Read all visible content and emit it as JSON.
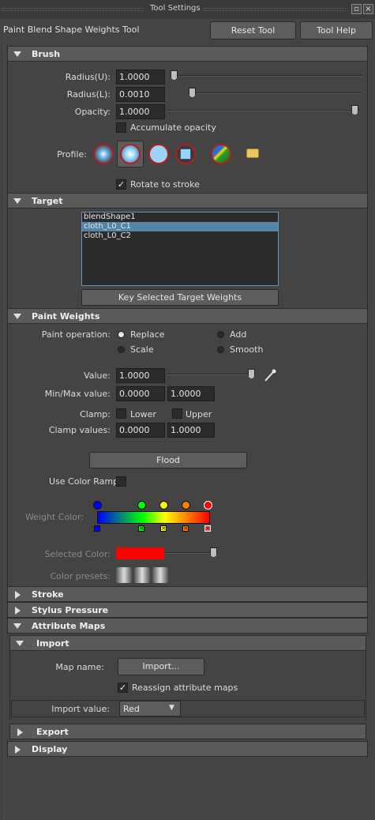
{
  "window": {
    "title": "Tool Settings"
  },
  "tool": {
    "name": "Paint Blend Shape Weights Tool",
    "reset_label": "Reset Tool",
    "help_label": "Tool Help"
  },
  "brush": {
    "header": "Brush",
    "radius_u_label": "Radius(U):",
    "radius_u_value": "1.0000",
    "radius_l_label": "Radius(L):",
    "radius_l_value": "0.0010",
    "opacity_label": "Opacity:",
    "opacity_value": "1.0000",
    "accumulate_label": "Accumulate opacity",
    "profile_label": "Profile:",
    "rotate_label": "Rotate to stroke"
  },
  "target": {
    "header": "Target",
    "items": [
      "blendShape1",
      "cloth_L0_C1",
      "cloth_L0_C2"
    ],
    "selected": "cloth_L0_C1",
    "key_button": "Key Selected Target Weights"
  },
  "paint_weights": {
    "header": "Paint Weights",
    "operation_label": "Paint operation:",
    "ops": [
      "Replace",
      "Add",
      "Scale",
      "Smooth"
    ],
    "selected_op": "Replace",
    "value_label": "Value:",
    "value": "1.0000",
    "minmax_label": "Min/Max value:",
    "min": "0.0000",
    "max": "1.0000",
    "clamp_label": "Clamp:",
    "clamp_lower": "Lower",
    "clamp_upper": "Upper",
    "clamp_values_label": "Clamp values:",
    "clamp_min": "0.0000",
    "clamp_max": "1.0000",
    "flood_label": "Flood",
    "color_ramp_label": "Use Color Ramp",
    "weight_color_label": "Weight Color:",
    "selected_color_label": "Selected Color:",
    "selected_color": "#ff0000",
    "color_presets_label": "Color presets:"
  },
  "sections": {
    "stroke": "Stroke",
    "stylus": "Stylus Pressure",
    "attribute_maps": "Attribute Maps"
  },
  "import": {
    "header": "Import",
    "map_name_label": "Map name:",
    "import_button": "Import...",
    "reassign_label": "Reassign attribute maps",
    "import_value_label": "Import value:",
    "import_value": "Red"
  },
  "export": {
    "header": "Export"
  },
  "display": {
    "header": "Display"
  },
  "colors": {
    "ramp": [
      "#0000ff",
      "#00ff00",
      "#ffff00",
      "#ff8000",
      "#ff0000"
    ]
  }
}
